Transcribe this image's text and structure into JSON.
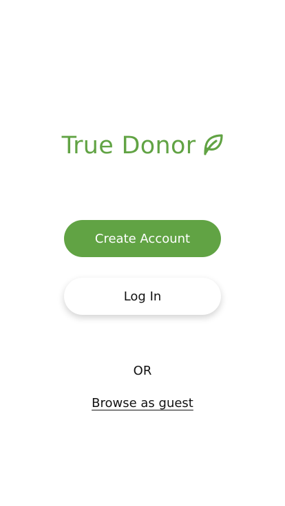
{
  "brand": {
    "name": "True Donor",
    "icon": "leaf-icon",
    "color": "#61a344"
  },
  "actions": {
    "create_account_label": "Create Account",
    "login_label": "Log In",
    "or_label": "OR",
    "browse_guest_label": "Browse as guest"
  }
}
